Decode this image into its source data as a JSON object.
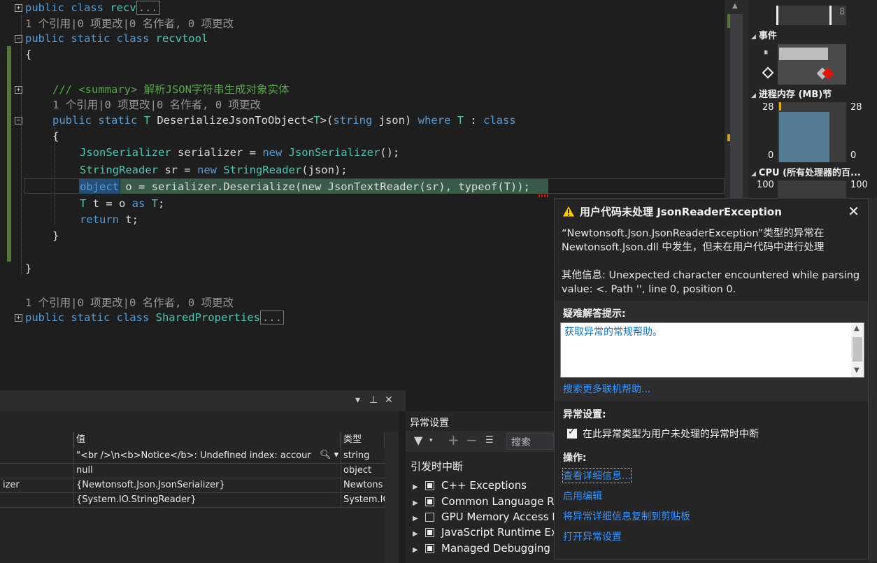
{
  "editor": {
    "lines": [
      {
        "kind": "code",
        "fold": "+",
        "parts": [
          {
            "c": "kw",
            "t": "public class "
          },
          {
            "c": "ty",
            "t": "recv"
          }
        ],
        "ellipsis": "..."
      },
      {
        "kind": "lens",
        "text": "1 个引用|0 项更改|0 名作者, 0 项更改"
      },
      {
        "kind": "code",
        "fold": "−",
        "parts": [
          {
            "c": "kw",
            "t": "public static class "
          },
          {
            "c": "ty",
            "t": "recvtool"
          }
        ]
      },
      {
        "kind": "code",
        "parts": [
          {
            "c": "tx",
            "t": "{"
          }
        ]
      },
      {
        "kind": "code",
        "fold": "+",
        "parts": [
          {
            "c": "cm",
            "t": "/// <summary> 解析JSON字符串生成对象实体"
          }
        ]
      },
      {
        "kind": "lens",
        "text": "1 个引用|0 项更改|0 名作者, 0 项更改"
      },
      {
        "kind": "code",
        "fold": "−",
        "parts": [
          {
            "c": "kw",
            "t": "public static "
          },
          {
            "c": "ty",
            "t": "T "
          },
          {
            "c": "tx",
            "t": "DeserializeJsonToObject<"
          },
          {
            "c": "ty",
            "t": "T"
          },
          {
            "c": "tx",
            "t": ">("
          },
          {
            "c": "kw",
            "t": "string"
          },
          {
            "c": "tx",
            "t": " json) "
          },
          {
            "c": "kw",
            "t": "where "
          },
          {
            "c": "ty",
            "t": "T"
          },
          {
            "c": "tx",
            "t": " : "
          },
          {
            "c": "kw",
            "t": "class"
          }
        ]
      },
      {
        "kind": "code",
        "parts": [
          {
            "c": "tx",
            "t": "{"
          }
        ]
      },
      {
        "kind": "code",
        "parts": [
          {
            "c": "ty",
            "t": "JsonSerializer"
          },
          {
            "c": "tx",
            "t": " serializer = "
          },
          {
            "c": "kw",
            "t": "new "
          },
          {
            "c": "ty",
            "t": "JsonSerializer"
          },
          {
            "c": "tx",
            "t": "();"
          }
        ]
      },
      {
        "kind": "code",
        "parts": [
          {
            "c": "ty",
            "t": "StringReader"
          },
          {
            "c": "tx",
            "t": " sr = "
          },
          {
            "c": "kw",
            "t": "new "
          },
          {
            "c": "ty",
            "t": "StringReader"
          },
          {
            "c": "tx",
            "t": "(json);"
          }
        ]
      },
      {
        "kind": "code",
        "parts": [
          {
            "c": "kw",
            "t": "object"
          },
          {
            "c": "tx",
            "t": " o = serializer.Deserialize(new JsonTextReader(sr), typeof(T));"
          }
        ]
      },
      {
        "kind": "code",
        "parts": [
          {
            "c": "ty",
            "t": "T"
          },
          {
            "c": "tx",
            "t": " t = o "
          },
          {
            "c": "kw",
            "t": "as "
          },
          {
            "c": "ty",
            "t": "T"
          },
          {
            "c": "tx",
            "t": ";"
          }
        ]
      },
      {
        "kind": "code",
        "parts": [
          {
            "c": "kw",
            "t": "return"
          },
          {
            "c": "tx",
            "t": " t;"
          }
        ]
      },
      {
        "kind": "code",
        "parts": [
          {
            "c": "tx",
            "t": "}"
          }
        ]
      },
      {
        "kind": "code",
        "parts": [
          {
            "c": "tx",
            "t": "}"
          }
        ]
      },
      {
        "kind": "lens",
        "text": "1 个引用|0 项更改|0 名作者, 0 项更改"
      },
      {
        "kind": "code",
        "fold": "+",
        "parts": [
          {
            "c": "kw",
            "t": "public static class "
          },
          {
            "c": "ty",
            "t": "SharedProperties"
          }
        ],
        "ellipsis": "..."
      }
    ]
  },
  "diagnostics": {
    "top_value": "8",
    "events_label": "事件",
    "memory_label": "进程内存 (MB)",
    "memory_suffix": "节",
    "memory_max_left": "28",
    "memory_max_right": "28",
    "memory_min_left": "0",
    "memory_min_right": "0",
    "cpu_label": "CPU (所有处理器的百...",
    "cpu_max_left": "100",
    "cpu_max_right": "100"
  },
  "locals": {
    "columns": [
      "值",
      "类型"
    ],
    "rows": [
      {
        "name": "",
        "value": "\"<br />\\n<b>Notice</b>:  Undefined index: accour",
        "type": "string"
      },
      {
        "name": "",
        "value": "null",
        "type": "object"
      },
      {
        "name": "izer",
        "value": "{Newtonsoft.Json.JsonSerializer}",
        "type": "Newtons"
      },
      {
        "name": "",
        "value": "{System.IO.StringReader}",
        "type": "System.IO"
      }
    ]
  },
  "exception_settings": {
    "title": "异常设置",
    "search_placeholder": "搜索",
    "break_when_thrown": "引发时中断",
    "items": [
      {
        "label": "C++ Exceptions",
        "checked": true
      },
      {
        "label": "Common Language Ru",
        "checked": true
      },
      {
        "label": "GPU Memory Access E",
        "checked": false
      },
      {
        "label": "JavaScript Runtime Exc",
        "checked": true
      },
      {
        "label": "Managed Debugging Assistants",
        "checked": true
      }
    ]
  },
  "popup": {
    "title": "用户代码未处理 JsonReaderException",
    "message_line1": "“Newtonsoft.Json.JsonReaderException”类型的异常在",
    "message_line2": "Newtonsoft.Json.dll 中发生，但未在用户代码中进行处理",
    "extra_line1": "其他信息: Unexpected character encountered while parsing",
    "extra_line2": "value: <. Path '', line 0, position 0.",
    "tips_label": "疑难解答提示:",
    "tip_link": "获取异常的常规帮助。",
    "search_more": "搜索更多联机帮助...",
    "settings_label": "异常设置:",
    "checkbox_label": "在此异常类型为用户未处理的异常时中断",
    "actions_label": "操作:",
    "action_details": "查看详细信息...",
    "action_edit": "启用编辑",
    "action_copy": "将异常详细信息复制到剪贴板",
    "action_open_settings": "打开异常设置",
    "warning_color": "#ffcc00"
  }
}
